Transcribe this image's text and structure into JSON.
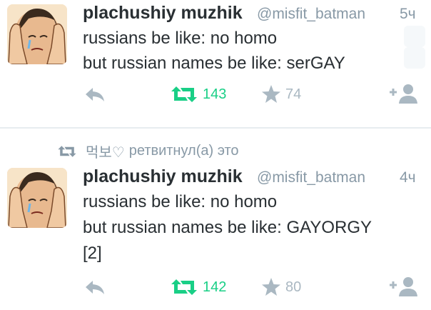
{
  "colors": {
    "retweet_green": "#19cf86",
    "icon_gray": "#aab8c2",
    "meta_gray": "#8899a6",
    "text": "#292f33"
  },
  "tweet1": {
    "author_name": "plachushiy muzhik",
    "handle": "@misfit_batman",
    "time": "5ч",
    "lines": [
      "russians be like: no homo",
      "but russian names be like: serGAY"
    ],
    "retweet_count": "143",
    "favorite_count": "74",
    "icons": [
      "reply-icon",
      "retweet-icon",
      "star-icon",
      "follow-icon"
    ]
  },
  "retweet_header": {
    "user": "먹보♡",
    "text": "ретвитнул(а) это"
  },
  "tweet2": {
    "author_name": "plachushiy muzhik",
    "handle": "@misfit_batman",
    "time": "4ч",
    "lines": [
      "russians be like: no homo",
      "but russian names be like: GAYORGY",
      "[2]"
    ],
    "retweet_count": "142",
    "favorite_count": "80",
    "icons": [
      "reply-icon",
      "retweet-icon",
      "star-icon",
      "follow-icon"
    ]
  }
}
